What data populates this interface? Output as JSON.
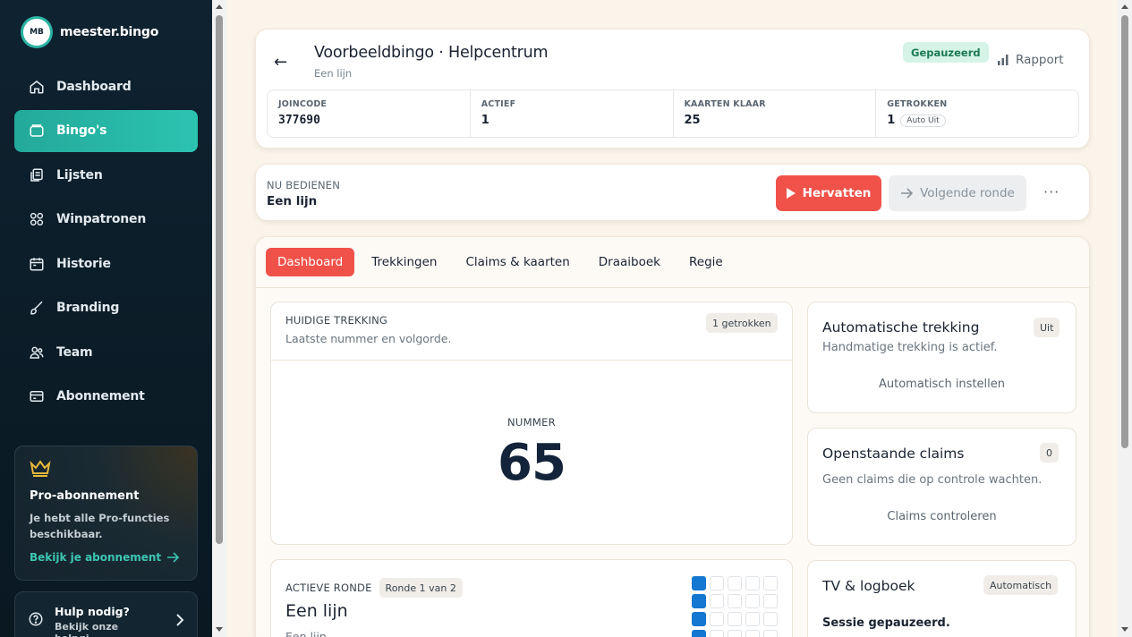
{
  "sidebar": {
    "logo_badge": "MB",
    "brand": "meester.bingo",
    "items": [
      {
        "label": "Dashboard",
        "icon": "home-icon"
      },
      {
        "label": "Bingo's",
        "icon": "bingo-card-icon",
        "active": true
      },
      {
        "label": "Lijsten",
        "icon": "copy-list-icon"
      },
      {
        "label": "Winpatronen",
        "icon": "grid-pattern-icon"
      },
      {
        "label": "Historie",
        "icon": "calendar-icon"
      },
      {
        "label": "Branding",
        "icon": "brush-icon"
      },
      {
        "label": "Team",
        "icon": "users-icon"
      },
      {
        "label": "Abonnement",
        "icon": "credit-card-icon"
      }
    ],
    "pro": {
      "title": "Pro-abonnement",
      "desc": "Je hebt alle Pro-functies beschikbaar.",
      "link": "Bekijk je abonnement"
    },
    "help": {
      "title": "Hulp nodig?",
      "sub": "Bekijk onze helpgi..."
    }
  },
  "header": {
    "title": "Voorbeeldbingo · Helpcentrum",
    "subtitle": "Een lijn",
    "status": "Gepauzeerd",
    "report": "Rapport",
    "stats": [
      {
        "label": "JOINCODE",
        "value": "377690"
      },
      {
        "label": "ACTIEF",
        "value": "1"
      },
      {
        "label": "KAARTEN KLAAR",
        "value": "25"
      },
      {
        "label": "GETROKKEN",
        "value": "1",
        "badge": "Auto Uit"
      }
    ]
  },
  "serve": {
    "label": "NU BEDIENEN",
    "value": "Een lijn",
    "resume": "Hervatten",
    "next": "Volgende ronde",
    "more": "···"
  },
  "tabs": [
    "Dashboard",
    "Trekkingen",
    "Claims & kaarten",
    "Draaiboek",
    "Regie"
  ],
  "current_draw": {
    "label": "HUIDIGE TREKKING",
    "sub": "Laatste nummer en volgorde.",
    "chip": "1 getrokken",
    "number_label": "NUMMER",
    "number": "65"
  },
  "auto_draw": {
    "title": "Automatische trekking",
    "chip": "Uit",
    "sub": "Handmatige trekking is actief.",
    "action": "Automatisch instellen"
  },
  "claims": {
    "title": "Openstaande claims",
    "chip": "0",
    "sub": "Geen claims die op controle wachten.",
    "action": "Claims controleren"
  },
  "active_round": {
    "label": "ACTIEVE RONDE",
    "chip": "Ronde 1 van 2",
    "title": "Een lijn",
    "sub": "Een lijn"
  },
  "tv": {
    "title": "TV & logboek",
    "chip": "Automatisch",
    "line": "Sessie gepauzeerd."
  },
  "colors": {
    "accent": "#2cc3b1",
    "danger": "#f0524a",
    "paused_bg": "#d5f4e7",
    "grid_on": "#1477d1"
  }
}
